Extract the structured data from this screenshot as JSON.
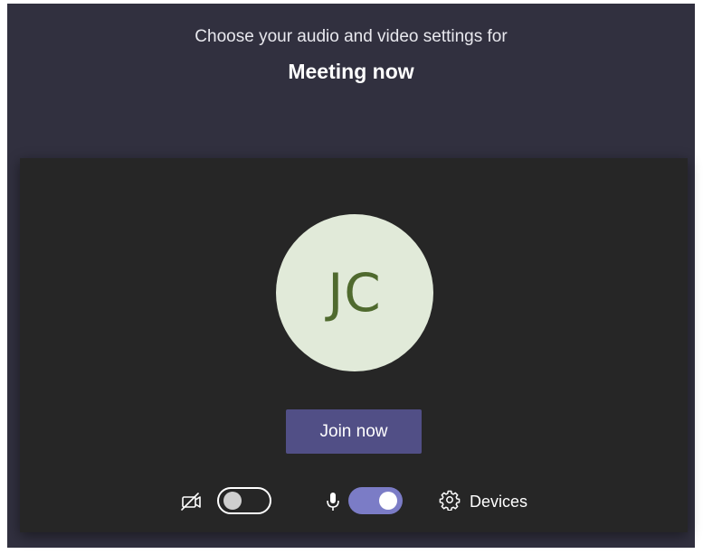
{
  "header": {
    "subtitle": "Choose your audio and video settings for",
    "title": "Meeting now"
  },
  "preview": {
    "avatar_initials": "JC",
    "avatar_color": "#e1ead9",
    "avatar_text_color": "#4f6a2e"
  },
  "actions": {
    "join_label": "Join now",
    "join_color": "#514f86"
  },
  "controls": {
    "camera": {
      "icon": "camera-off-icon",
      "enabled": false
    },
    "microphone": {
      "icon": "microphone-icon",
      "enabled": true
    },
    "devices": {
      "icon": "gear-icon",
      "label": "Devices"
    },
    "toggle_on_color": "#7b7cc6"
  }
}
